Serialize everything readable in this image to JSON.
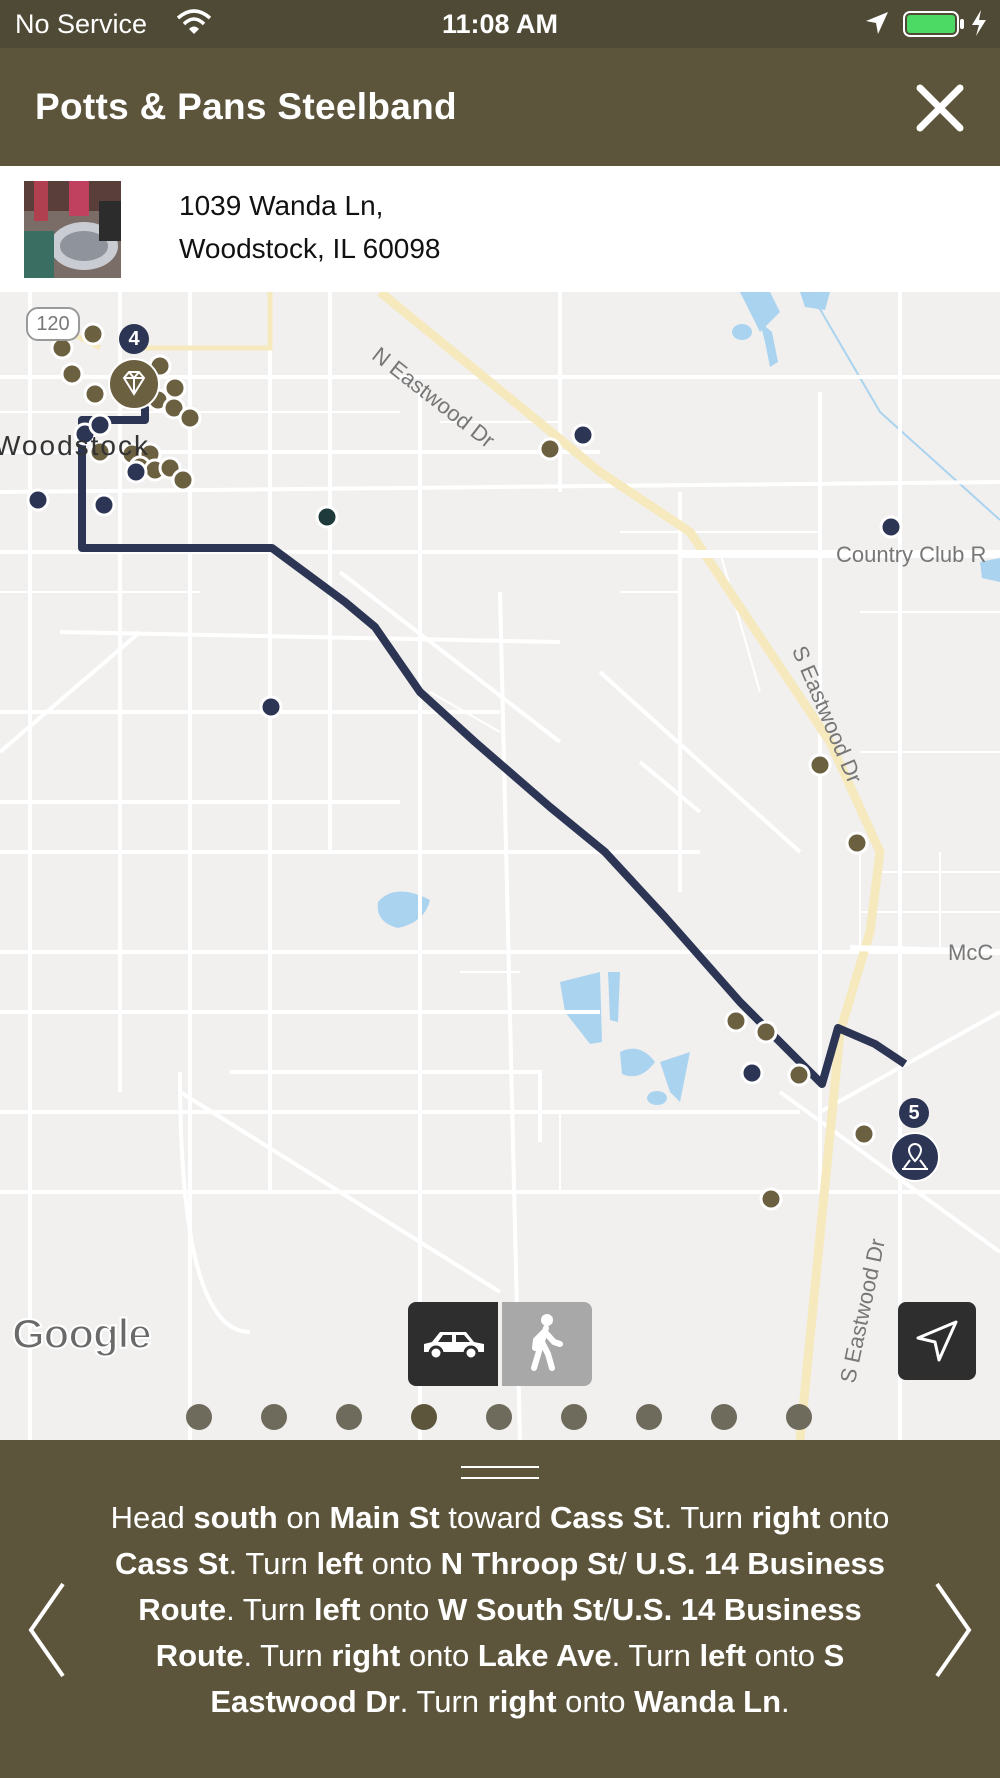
{
  "status_bar": {
    "carrier": "No Service",
    "time": "11:08 AM",
    "battery_color": "#4cd964"
  },
  "header": {
    "title": "Potts & Pans Steelband",
    "close_icon": "close-icon"
  },
  "location": {
    "address_line1": "1039 Wanda Ln,",
    "address_line2": "Woodstock, IL 60098"
  },
  "map": {
    "labels": {
      "route_shield": "120",
      "road_n_eastwood": "N Eastwood Dr",
      "road_s_eastwood": "S Eastwood Dr",
      "road_s_eastwood_lower": "S Eastwood Dr",
      "road_country_club": "Country Club R",
      "road_mcc": "McC",
      "town": "Woodstock"
    },
    "markers": {
      "start_badge": "4",
      "end_badge": "5"
    },
    "colors": {
      "route": "#2d3555",
      "poi_brown": "#6b6040",
      "poi_navy": "#2d3555",
      "major_road": "#f5e9bd",
      "water": "#aad3f0"
    },
    "travel_modes": [
      "car",
      "walk"
    ],
    "selected_mode": "car",
    "page_count": 9,
    "active_page": 4
  },
  "directions": {
    "segments": [
      {
        "t": "Head ",
        "b": false
      },
      {
        "t": "south",
        "b": true
      },
      {
        "t": " on ",
        "b": false
      },
      {
        "t": "Main St",
        "b": true
      },
      {
        "t": " toward ",
        "b": false
      },
      {
        "t": "Cass St",
        "b": true
      },
      {
        "t": ". Turn ",
        "b": false
      },
      {
        "t": "right",
        "b": true
      },
      {
        "t": " onto ",
        "b": false
      },
      {
        "t": "Cass St",
        "b": true
      },
      {
        "t": ". Turn ",
        "b": false
      },
      {
        "t": "left",
        "b": true
      },
      {
        "t": " onto ",
        "b": false
      },
      {
        "t": "N Throop St",
        "b": true
      },
      {
        "t": "/ ",
        "b": false
      },
      {
        "t": "U.S. 14 Business Route",
        "b": true
      },
      {
        "t": ". Turn ",
        "b": false
      },
      {
        "t": "left",
        "b": true
      },
      {
        "t": " onto ",
        "b": false
      },
      {
        "t": "W South St",
        "b": true
      },
      {
        "t": "/",
        "b": false
      },
      {
        "t": "U.S. 14 Business Route",
        "b": true
      },
      {
        "t": ". Turn ",
        "b": false
      },
      {
        "t": "right",
        "b": true
      },
      {
        "t": " onto ",
        "b": false
      },
      {
        "t": "Lake Ave",
        "b": true
      },
      {
        "t": ". Turn ",
        "b": false
      },
      {
        "t": "left",
        "b": true
      },
      {
        "t": " onto ",
        "b": false
      },
      {
        "t": "S Eastwood Dr",
        "b": true
      },
      {
        "t": ". Turn ",
        "b": false
      },
      {
        "t": "right",
        "b": true
      },
      {
        "t": " onto ",
        "b": false
      },
      {
        "t": "Wanda Ln",
        "b": true
      },
      {
        "t": ".",
        "b": false
      }
    ]
  }
}
